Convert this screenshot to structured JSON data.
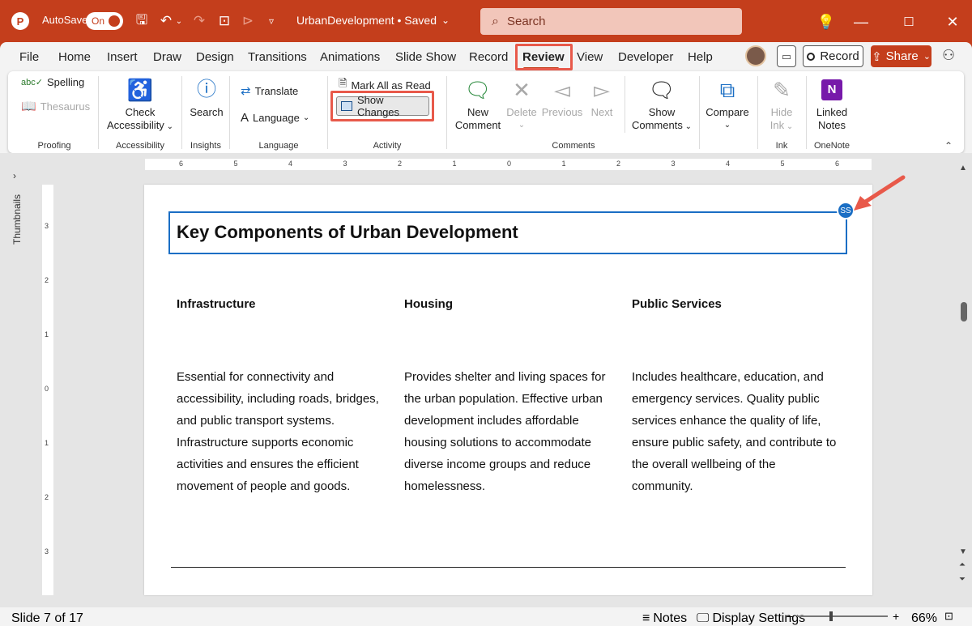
{
  "titlebar": {
    "autosave_label": "AutoSave",
    "autosave_state": "On",
    "doc_title": "UrbanDevelopment • Saved",
    "search_placeholder": "Search"
  },
  "tabs": [
    "File",
    "Home",
    "Insert",
    "Draw",
    "Design",
    "Transitions",
    "Animations",
    "Slide Show",
    "Record",
    "Review",
    "View",
    "Developer",
    "Help"
  ],
  "active_tab": "Review",
  "header_buttons": {
    "record": "Record",
    "share": "Share"
  },
  "ribbon": {
    "proofing": {
      "label": "Proofing",
      "spelling": "Spelling",
      "thesaurus": "Thesaurus"
    },
    "accessibility": {
      "label": "Accessibility",
      "check1": "Check",
      "check2": "Accessibility"
    },
    "insights": {
      "label": "Insights",
      "search": "Search"
    },
    "language": {
      "label": "Language",
      "translate": "Translate",
      "language": "Language"
    },
    "activity": {
      "label": "Activity",
      "mark_all": "Mark All as Read",
      "show_changes": "Show Changes"
    },
    "comments": {
      "label": "Comments",
      "new1": "New",
      "new2": "Comment",
      "delete": "Delete",
      "previous": "Previous",
      "next": "Next",
      "show1": "Show",
      "show2": "Comments"
    },
    "compare": {
      "label": "Compare"
    },
    "ink": {
      "label": "Ink",
      "hide1": "Hide",
      "hide2": "Ink"
    },
    "onenote": {
      "label": "OneNote",
      "linked1": "Linked",
      "linked2": "Notes"
    }
  },
  "thumbnails_label": "Thumbnails",
  "ruler": {
    "h_labels": [
      "6",
      "5",
      "4",
      "3",
      "2",
      "1",
      "0",
      "1",
      "2",
      "3",
      "4",
      "5",
      "6"
    ],
    "v_labels": [
      "3",
      "2",
      "1",
      "0",
      "1",
      "2",
      "3"
    ]
  },
  "slide": {
    "title": "Key Components of Urban Development",
    "author_badge": "SS",
    "columns": [
      {
        "heading": "Infrastructure",
        "body": "Essential for connectivity and accessibility, including roads, bridges, and public transport systems. Infrastructure supports economic activities and ensures the efficient movement of people and goods."
      },
      {
        "heading": "Housing",
        "body": "Provides shelter and living spaces for the urban population. Effective urban development includes affordable housing solutions to accommodate diverse income groups and reduce homelessness."
      },
      {
        "heading": "Public Services",
        "body": "Includes healthcare, education, and emergency services. Quality public services enhance the quality of life, ensure public safety, and contribute to the overall wellbeing of the community."
      }
    ]
  },
  "statusbar": {
    "slide_info": "Slide 7 of 17",
    "notes": "Notes",
    "display_settings": "Display Settings",
    "zoom": "66%"
  },
  "colors": {
    "accent": "#c43e1c",
    "selection": "#1a6ec4",
    "highlight": "#e8594a"
  }
}
